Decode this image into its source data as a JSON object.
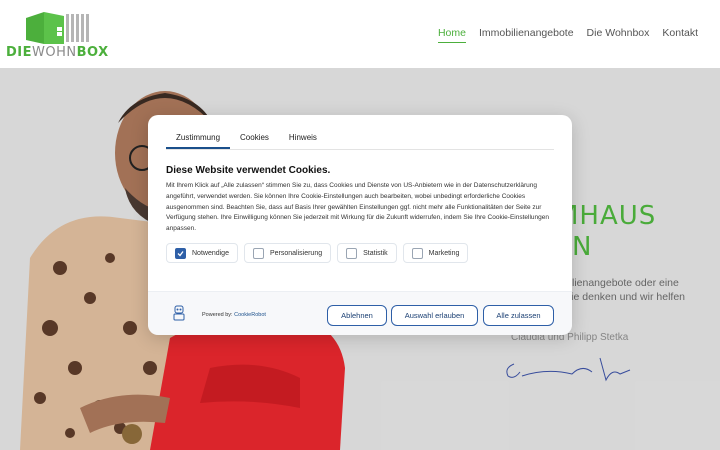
{
  "logo": {
    "part1": "DIE",
    "part2": "WOHN",
    "part3": "BOX"
  },
  "nav": {
    "home": "Home",
    "immobilien": "Immobilienangebote",
    "wohnbox": "Die Wohnbox",
    "kontakt": "Kontakt"
  },
  "hero": {
    "heading_line1": "MHAUS",
    "heading_line2": "N",
    "text_line1": "lienangebote oder eine",
    "text_line2": "s Sie denken und wir helfen",
    "names": "Claudia und Philipp Stetka"
  },
  "consent": {
    "tabs": [
      "Zustimmung",
      "Cookies",
      "Hinweis"
    ],
    "title": "Diese Website verwendet Cookies.",
    "text": "Mit Ihrem Klick auf „Alle zulassen“ stimmen Sie zu, dass Cookies und Dienste von US-Anbietern wie in der Datenschutzerklärung angeführt, verwendet werden. Sie können Ihre Cookie-Einstellungen auch bearbeiten, wobei unbedingt erforderliche Cookies ausgenommen sind. Beachten Sie, dass auf Basis Ihrer gewählten Einstellungen ggf. nicht mehr alle Funktionalitäten der Seite zur Verfügung stehen. Ihre Einwilligung können Sie jederzeit mit Wirkung für die Zukunft widerrufen, indem Sie Ihre Cookie-Einstellungen anpassen.",
    "categories": [
      {
        "label": "Notwendige",
        "checked": true
      },
      {
        "label": "Personalisierung",
        "checked": false
      },
      {
        "label": "Statistik",
        "checked": false
      },
      {
        "label": "Marketing",
        "checked": false
      }
    ],
    "powered_by": "Powered by:",
    "powered_link": "CookieRobot",
    "buttons": {
      "decline": "Ablehnen",
      "selection": "Auswahl erlauben",
      "all": "Alle zulassen"
    }
  },
  "colors": {
    "brand_green": "#4caf3c",
    "button_blue": "#2e5fa7"
  }
}
